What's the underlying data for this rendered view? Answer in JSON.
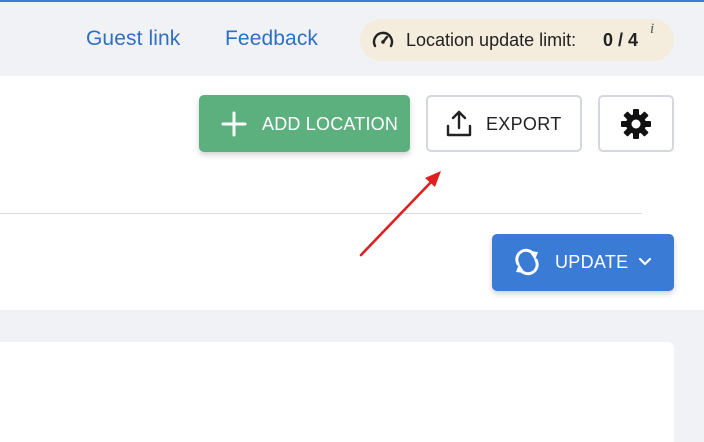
{
  "header": {
    "guest_link": "Guest link",
    "feedback": "Feedback",
    "limit": {
      "label": "Location update limit:",
      "value": "0 / 4",
      "info": "i",
      "icon": "gauge-icon"
    }
  },
  "toolbar": {
    "add_location": "ADD LOCATION",
    "export": "EXPORT",
    "settings_icon": "gear-icon",
    "update": "UPDATE"
  },
  "colors": {
    "accent_blue": "#3a7bd5",
    "link_blue": "#2f6fc4",
    "add_green": "#5bb07e",
    "annotation_red": "#e02020",
    "limit_bg": "#f4ecdd"
  }
}
